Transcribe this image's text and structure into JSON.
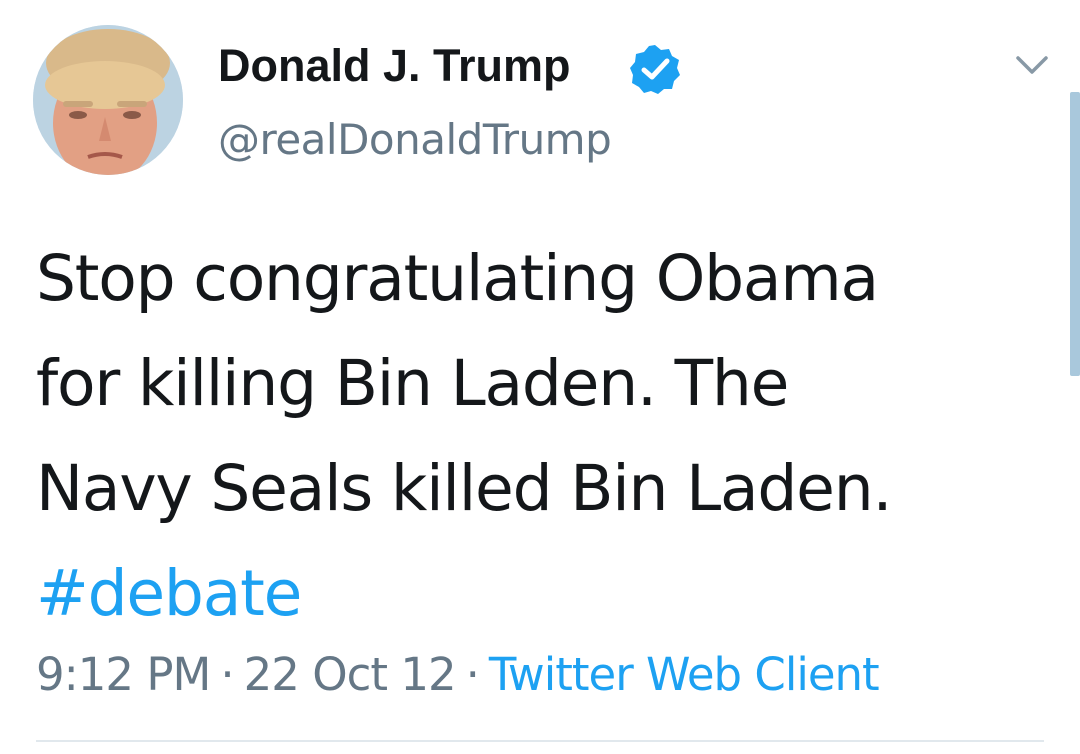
{
  "user": {
    "display_name": "Donald J. Trump",
    "handle": "@realDonaldTrump",
    "verified": true
  },
  "tweet": {
    "lines": [
      "Stop congratulating Obama",
      "for killing Bin Laden. The",
      "Navy Seals killed Bin Laden."
    ],
    "hashtag": "#debate",
    "time": "9:12 PM",
    "date": "22 Oct 12",
    "source": "Twitter Web Client",
    "separator": "·"
  },
  "icons": {
    "verified": "verified-badge-icon",
    "menu": "chevron-down-icon"
  },
  "colors": {
    "text": "#14171a",
    "secondary": "#657786",
    "link": "#1da1f2",
    "divider": "#e1e8ed"
  }
}
